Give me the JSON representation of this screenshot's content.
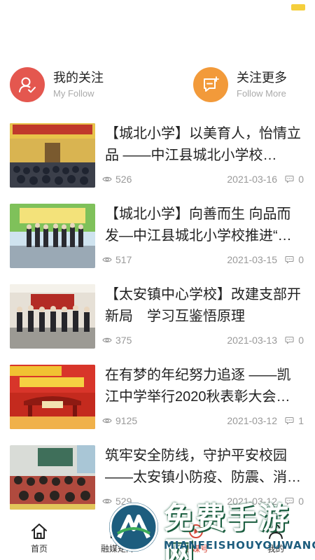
{
  "follow": {
    "my_follow": {
      "title": "我的关注",
      "subtitle": "My Follow"
    },
    "follow_more": {
      "title": "关注更多",
      "subtitle": "Follow  More"
    }
  },
  "articles": [
    {
      "title": "【城北小学】以美育人，怡情立品 ——中江县城北小学校…",
      "views": "526",
      "date": "2021-03-16",
      "comments": "0"
    },
    {
      "title": "【城北小学】向善而生 向品而发—中江县城北小学校推进“…",
      "views": "517",
      "date": "2021-03-15",
      "comments": "0"
    },
    {
      "title": "【太安镇中心学校】改建支部开新局　学习互鉴悟原理",
      "views": "375",
      "date": "2021-03-13",
      "comments": "0"
    },
    {
      "title": "在有梦的年纪努力追逐 ——凯江中学举行2020秋表彰大会…",
      "views": "9125",
      "date": "2021-03-12",
      "comments": "1"
    },
    {
      "title": "筑牢安全防线，守护平安校园——太安镇小防疫、防震、消…",
      "views": "529",
      "date": "2021-03-12",
      "comments": "0"
    }
  ],
  "tabs": [
    {
      "label": "首页"
    },
    {
      "label": "融媒矩阵"
    },
    {
      "label": "融媒号"
    },
    {
      "label": "我的"
    }
  ],
  "colors": {
    "accent": "#d84a3c",
    "follow_red": "#e4574f",
    "follow_orange": "#f29a3a"
  },
  "watermark": {
    "main": "免费手游网",
    "sub": "MIANFEISHOUYOUWANG"
  }
}
